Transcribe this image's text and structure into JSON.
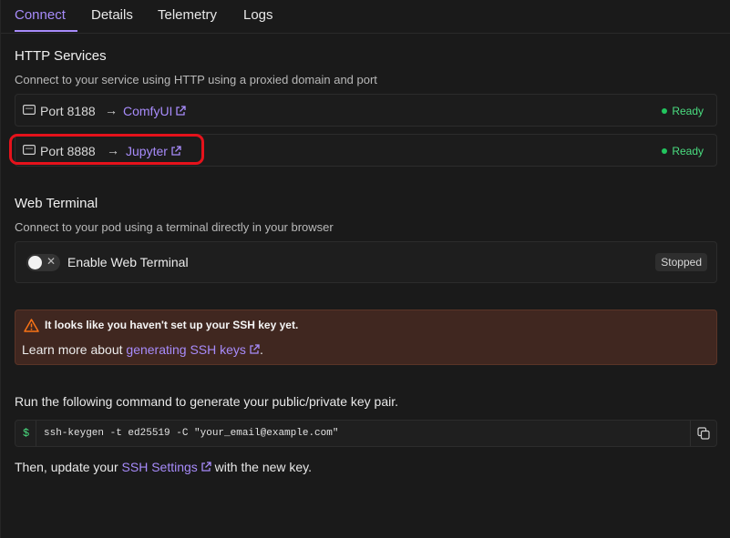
{
  "tabs": [
    {
      "label": "Connect",
      "active": true
    },
    {
      "label": "Details",
      "active": false
    },
    {
      "label": "Telemetry",
      "active": false
    },
    {
      "label": "Logs",
      "active": false
    }
  ],
  "http": {
    "title": "HTTP Services",
    "subtitle": "Connect to your service using HTTP using a proxied domain and port",
    "services": [
      {
        "port": "Port 8188",
        "arrow": "→",
        "name": "ComfyUI",
        "status": "Ready"
      },
      {
        "port": "Port 8888",
        "arrow": "→",
        "name": "Jupyter",
        "status": "Ready"
      }
    ]
  },
  "terminal": {
    "title": "Web Terminal",
    "subtitle": "Connect to your pod using a terminal directly in your browser",
    "toggle_label": "Enable Web Terminal",
    "toggle_on": false,
    "toggle_x": "✕",
    "status": "Stopped"
  },
  "ssh_warning": {
    "title": "It looks like you haven't set up your SSH key yet.",
    "text_prefix": "Learn more about ",
    "link": "generating SSH keys",
    "text_suffix": "."
  },
  "keygen": {
    "instruction": "Run the following command to generate your public/private key pair.",
    "prompt": "$",
    "command": "ssh-keygen -t ed25519 -C \"your_email@example.com\""
  },
  "then": {
    "prefix": "Then, update your ",
    "link": "SSH Settings",
    "suffix": " with the new key."
  },
  "colors": {
    "accent": "#a78bfa",
    "ready": "#22c55e",
    "warning_bg": "#402720",
    "warning_icon": "#f97316",
    "highlight": "#e5121b"
  }
}
